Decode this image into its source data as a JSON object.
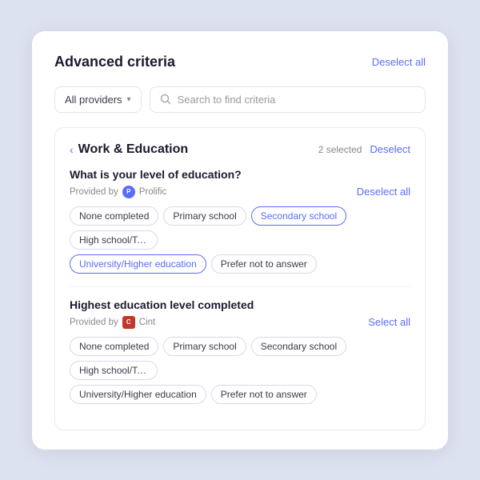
{
  "card": {
    "title": "Advanced criteria",
    "deselect_all_label": "Deselect all"
  },
  "filter": {
    "provider_label": "All providers",
    "search_placeholder": "Search to find criteria"
  },
  "section": {
    "back_label": "‹",
    "title": "Work & Education",
    "selected_count": "2 selected",
    "deselect_label": "Deselect"
  },
  "question1": {
    "title": "What is your level of education?",
    "provided_by_label": "Provided by",
    "provider_name": "Prolific",
    "deselect_all_label": "Deselect all",
    "tags": [
      {
        "label": "None completed",
        "selected": false
      },
      {
        "label": "Primary school",
        "selected": false
      },
      {
        "label": "Secondary school",
        "selected": true
      },
      {
        "label": "High school/Tech. cc",
        "selected": false,
        "truncated": true
      }
    ],
    "tags_row2": [
      {
        "label": "University/Higher education",
        "selected": true
      },
      {
        "label": "Prefer not to answer",
        "selected": false
      }
    ]
  },
  "question2": {
    "title": "Highest education level completed",
    "provided_by_label": "Provided by",
    "provider_name": "Cint",
    "select_all_label": "Select all",
    "tags": [
      {
        "label": "None completed",
        "selected": false
      },
      {
        "label": "Primary school",
        "selected": false
      },
      {
        "label": "Secondary school",
        "selected": false
      },
      {
        "label": "High school/Tech. cc",
        "selected": false,
        "truncated": true
      }
    ],
    "tags_row2": [
      {
        "label": "University/Higher education",
        "selected": false
      },
      {
        "label": "Prefer not to answer",
        "selected": false
      }
    ]
  }
}
